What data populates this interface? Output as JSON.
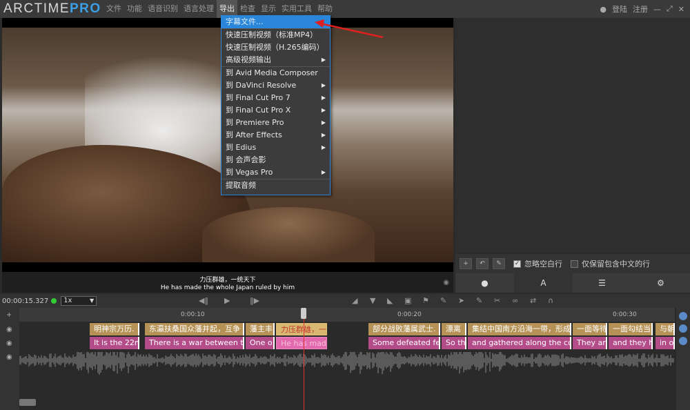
{
  "app": {
    "logo_main": "ARCTIME",
    "logo_pro": "PRO"
  },
  "menu": [
    "文件",
    "功能",
    "语音识别",
    "语言处理",
    "导出",
    "检查",
    "显示",
    "实用工具",
    "帮助"
  ],
  "window_controls": {
    "user_icon": "user-icon",
    "login": "登陆",
    "register": "注册"
  },
  "export_menu": {
    "items": [
      {
        "label": "字幕文件...",
        "submenu": false,
        "highlighted": true
      },
      {
        "label": "快速压制视频（标准MP4）",
        "submenu": false
      },
      {
        "label": "快速压制视频（H.265编码）",
        "submenu": false
      },
      {
        "label": "高级视频输出",
        "submenu": true
      },
      {
        "label": "到 Avid Media Composer",
        "submenu": false
      },
      {
        "label": "到 DaVinci Resolve",
        "submenu": true
      },
      {
        "label": "到 Final Cut Pro 7",
        "submenu": true
      },
      {
        "label": "到 Final Cut Pro X",
        "submenu": true
      },
      {
        "label": "到 Premiere Pro",
        "submenu": true
      },
      {
        "label": "到 After Effects",
        "submenu": true
      },
      {
        "label": "到 Edius",
        "submenu": true
      },
      {
        "label": "到 会声会影",
        "submenu": false
      },
      {
        "label": "到 Vegas Pro",
        "submenu": true
      },
      {
        "label": "提取音频",
        "submenu": false
      }
    ]
  },
  "video": {
    "subtitle_cn": "力压群雄，一统天下",
    "subtitle_en": "He has made the whole Japan ruled by him"
  },
  "right_panel": {
    "ignore_blank": "忽略空白行",
    "keep_chinese": "仅保留包含中文的行",
    "ignore_blank_checked": true,
    "keep_chinese_checked": false,
    "tabs": [
      "chat-icon",
      "A",
      "list-icon",
      "gear-icon"
    ]
  },
  "transport": {
    "timecode": "00:00:15.327",
    "speed": "1x"
  },
  "timeline": {
    "ticks": [
      "0:00:10",
      "0:00:20",
      "0:00:30"
    ],
    "cn_clips": [
      "明神宗万历.",
      "东瀛扶桑国众藩并起，互争",
      "藩主丰",
      "力压群雄，一",
      "部分战败藩属武士.",
      "漂离",
      "集结中国南方沿海一带，形成",
      "一面等待",
      "一面勾结当",
      "与朝"
    ],
    "en_clips": [
      "It is the 22n",
      "There is a war between t",
      "One o",
      "He has mad",
      "Some defeated fe",
      "So th",
      "and gathered along the co",
      "They ar",
      "and they h",
      "in o"
    ],
    "selected_index": 3,
    "playhead_position_pct": 0.433
  }
}
